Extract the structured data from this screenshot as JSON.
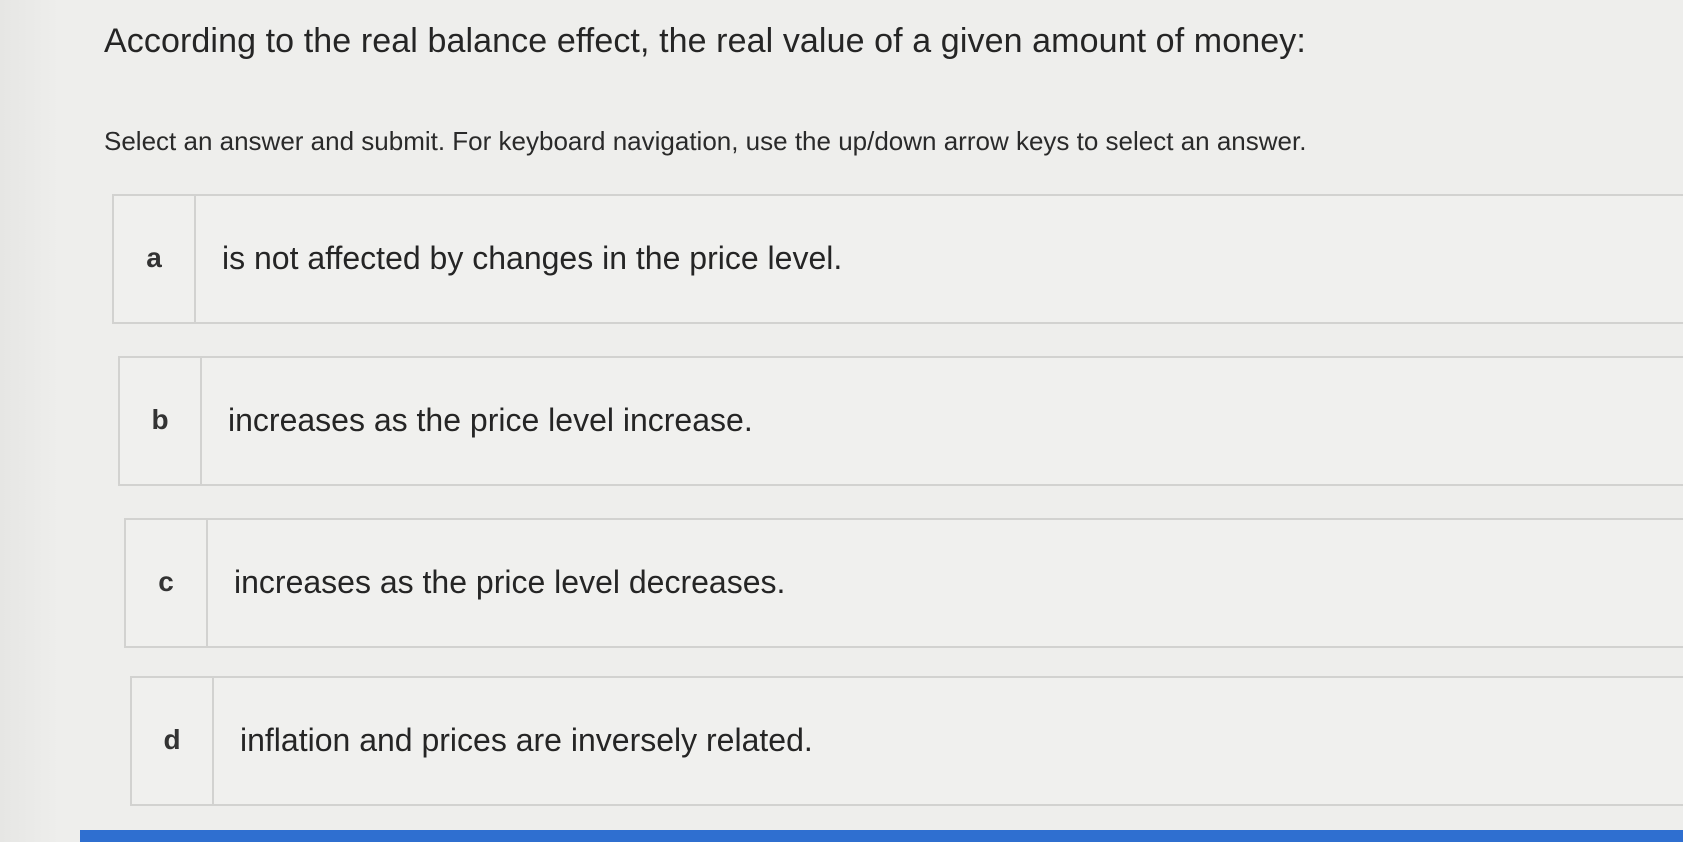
{
  "question": {
    "prompt": "According to the real balance effect, the real value of a given amount of money:",
    "instructions": "Select an answer and submit. For keyboard navigation, use the up/down arrow keys to select an answer."
  },
  "options": [
    {
      "letter": "a",
      "text": "is not affected by changes in the price level."
    },
    {
      "letter": "b",
      "text": "increases as the price level increase."
    },
    {
      "letter": "c",
      "text": "increases as the price level decreases."
    },
    {
      "letter": "d",
      "text": "inflation and prices are inversely related."
    }
  ],
  "colors": {
    "background": "#eeeeec",
    "border": "#d2d2d0",
    "accent_bar": "#2f6fd0"
  }
}
